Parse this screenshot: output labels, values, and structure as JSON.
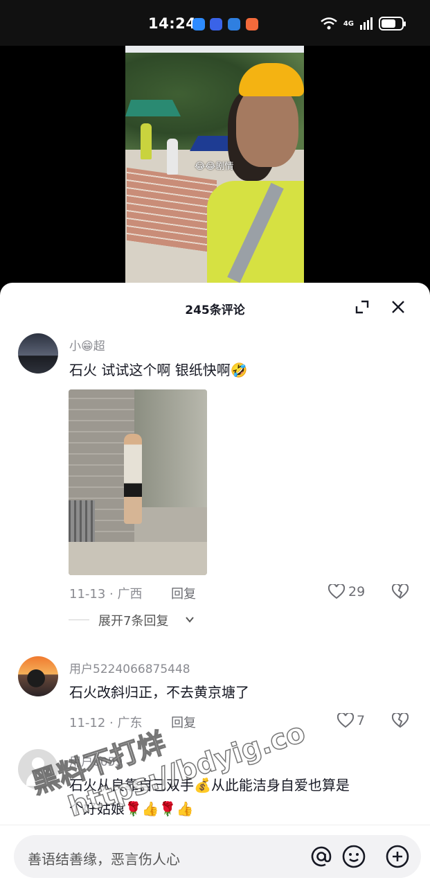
{
  "status_bar": {
    "time": "14:24",
    "network": "4G",
    "app_icons": [
      "shield-app-icon",
      "blue-app-icon",
      "globe-app-icon",
      "orange-app-icon"
    ]
  },
  "video": {
    "caption": "😂😂剧情"
  },
  "comments_panel": {
    "title": "245条评论",
    "comments": [
      {
        "username": "小😁超",
        "text": "石火 试试这个啊 银纸快啊🤣",
        "date_location": "11-13 · 广西",
        "reply_label": "回复",
        "likes": "29",
        "expand_replies": "展开7条回复"
      },
      {
        "username": "用户5224066875448",
        "text": "石火改斜归正，不去黄京塘了",
        "date_location": "11-12 · 广东",
        "reply_label": "回复",
        "likes": "7"
      },
      {
        "username": "用户6059",
        "text_line1": "石火从良靠自己双手💰从此能洁身自爱也算是",
        "text_line2": "个好姑娘🌹👍🌹👍"
      }
    ]
  },
  "watermark": {
    "line1": "黑料不打烊",
    "line2": "https://bdyig.co"
  },
  "input_bar": {
    "placeholder": "善语结善缘，恶言伤人心"
  },
  "colors": {
    "text_primary": "#161823",
    "text_secondary": "#8a8b91",
    "sheet_bg": "#ffffff",
    "input_bg": "#f2f2f4"
  }
}
